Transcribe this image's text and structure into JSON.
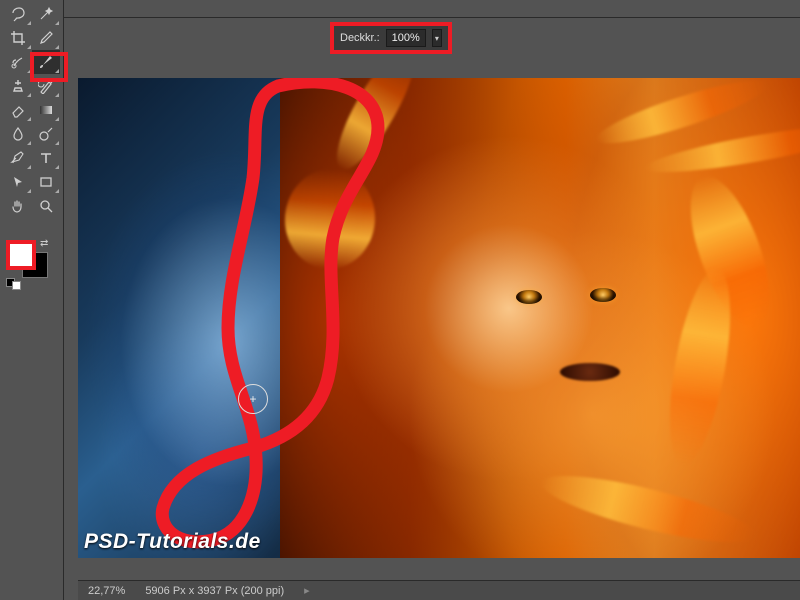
{
  "options": {
    "opacity_label": "Deckkr.:",
    "opacity_value": "100%"
  },
  "tools": {
    "items": [
      {
        "name": "lasso-tool"
      },
      {
        "name": "magic-wand-tool"
      },
      {
        "name": "crop-tool"
      },
      {
        "name": "eyedropper-tool"
      },
      {
        "name": "healing-brush-tool"
      },
      {
        "name": "brush-tool"
      },
      {
        "name": "clone-stamp-tool"
      },
      {
        "name": "history-brush-tool"
      },
      {
        "name": "eraser-tool"
      },
      {
        "name": "gradient-tool"
      },
      {
        "name": "blur-tool"
      },
      {
        "name": "dodge-tool"
      },
      {
        "name": "pen-tool"
      },
      {
        "name": "type-tool"
      },
      {
        "name": "path-select-tool"
      },
      {
        "name": "rectangle-tool"
      },
      {
        "name": "hand-tool"
      },
      {
        "name": "zoom-tool"
      }
    ]
  },
  "swatches": {
    "foreground": "#ffffff",
    "background": "#000000"
  },
  "canvas": {
    "watermark": "PSD-Tutorials.de"
  },
  "status": {
    "zoom": "22,77%",
    "dimensions": "5906 Px x 3937 Px (200 ppi)",
    "arrow": "▸"
  },
  "highlight_color": "#ee1c25"
}
